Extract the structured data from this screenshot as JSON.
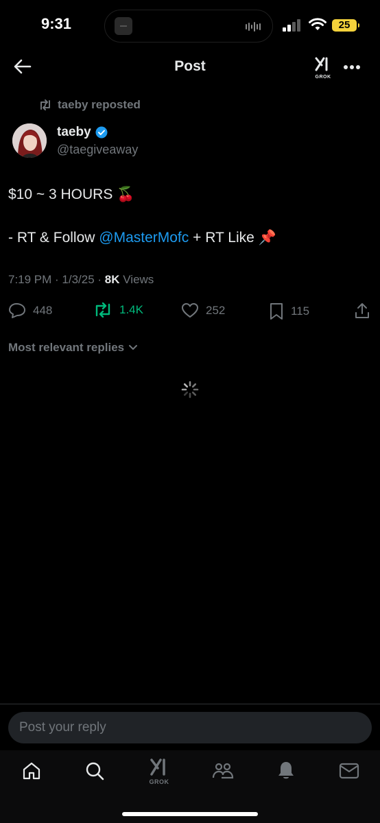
{
  "status_bar": {
    "time": "9:31",
    "battery": "25"
  },
  "header": {
    "title": "Post",
    "grok_label": "GROK"
  },
  "tweet": {
    "repost_label": "taeby reposted",
    "author_name": "taeby",
    "author_handle": "@taegiveaway",
    "line1": "$10 ~ 3 HOURS 🍒",
    "line2_prefix": "- RT & Follow ",
    "line2_mention": "@MasterMofc",
    "line2_suffix": " + RT Like 📌",
    "timestamp": "7:19 PM · 1/3/25 · ",
    "views_count": "8K",
    "views_label": " Views"
  },
  "actions": {
    "replies": "448",
    "reposts": "1.4K",
    "likes": "252",
    "bookmarks": "115"
  },
  "replies_sort": "Most relevant replies",
  "reply_placeholder": "Post your reply",
  "tabbar": {
    "grok_label": "GROK"
  },
  "colors": {
    "accent": "#1d9bf0",
    "repost_green": "#00ba7c",
    "muted": "#71767b",
    "battery": "#f4d23b"
  }
}
